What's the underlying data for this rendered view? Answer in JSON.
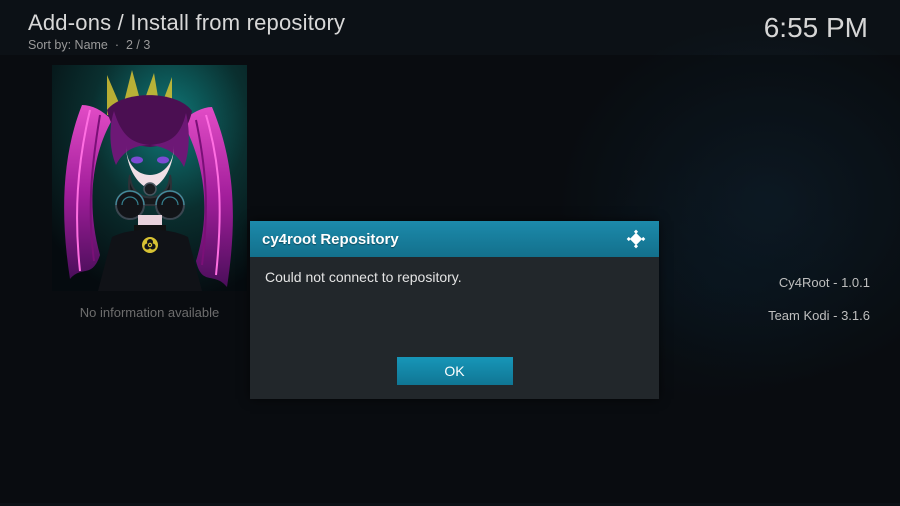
{
  "header": {
    "breadcrumb": "Add-ons / Install from repository",
    "sort_label": "Sort by: Name",
    "position": "2 / 3"
  },
  "clock": "6:55 PM",
  "thumbnail": {
    "caption": "No information available"
  },
  "meta": [
    {
      "name": "Cy4Root",
      "version": "1.0.1"
    },
    {
      "name": "Team Kodi",
      "version": "3.1.6"
    }
  ],
  "dialog": {
    "title": "cy4root Repository",
    "message": "Could not connect to repository.",
    "ok_label": "OK",
    "logo_name": "kodi-logo"
  },
  "colors": {
    "accent": "#1688a9",
    "panel": "#22272b",
    "bg": "#0c1116"
  }
}
